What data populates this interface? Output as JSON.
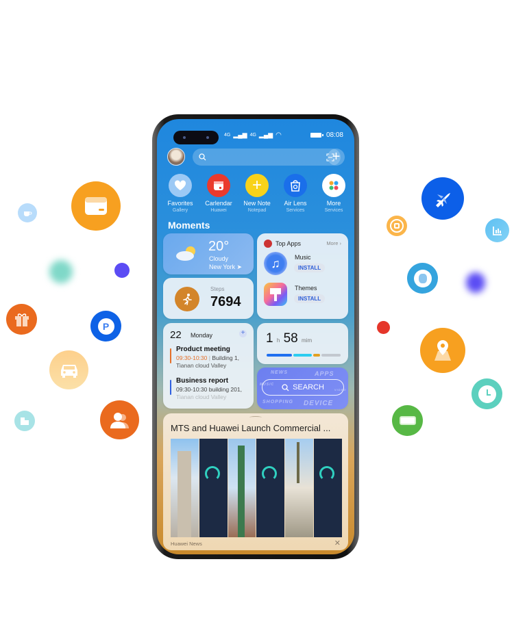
{
  "status_bar": {
    "signal1": "4G",
    "signal2": "4G",
    "time": "08:08"
  },
  "search": {
    "placeholder": ""
  },
  "quick_apps": [
    {
      "label": "Favorites",
      "sublabel": "Gallery",
      "icon": "heart-icon",
      "color": "#9cc9f5"
    },
    {
      "label": "Carlendar",
      "sublabel": "Huawei",
      "icon": "calendar-icon",
      "color": "#ea3a2d"
    },
    {
      "label": "New Note",
      "sublabel": "Notepad",
      "icon": "plus-icon",
      "color": "#f8d21a"
    },
    {
      "label": "Air Lens",
      "sublabel": "Services",
      "icon": "bag-icon",
      "color": "#1a6fea"
    },
    {
      "label": "More",
      "sublabel": "Services",
      "icon": "grid-icon",
      "color": "#ffffff"
    }
  ],
  "section_title": "Moments",
  "weather": {
    "temp": "20°",
    "condition": "Cloudy",
    "city": "New York"
  },
  "steps": {
    "label": "Steps",
    "value": "7694"
  },
  "top_apps": {
    "title": "Top Apps",
    "more": "More",
    "items": [
      {
        "name": "Music",
        "action": "INSTALL"
      },
      {
        "name": "Themes",
        "action": "INSTALL"
      }
    ]
  },
  "calendar": {
    "day": "22",
    "weekday": "Monday",
    "events": [
      {
        "title": "Product meeting",
        "time": "09:30-10:30",
        "location": "Building 1,",
        "location2": "Tianan cloud Valley",
        "color": "#e5702a"
      },
      {
        "title": "Business report",
        "time": "09:30-10:30",
        "location": "building 201,",
        "location2": "Tianan cloud Valley",
        "color": "#2f5fe0"
      }
    ]
  },
  "screen_time": {
    "hours": "1",
    "h_unit": "h",
    "minutes": "58",
    "m_unit": "mim"
  },
  "search_card": {
    "label": "SEARCH",
    "words": [
      "NEWS",
      "APPS",
      "MUSIC",
      "SHOPPING",
      "DEVICE",
      "VIDEO"
    ]
  },
  "news": {
    "headline": "MTS and Huawei Launch Commercial ...",
    "source": "Huawei News"
  },
  "floating_icons": [
    "coffee-icon",
    "wallet-icon",
    "blurred-dot",
    "purple-dot",
    "gift-icon",
    "parking-icon",
    "car-icon",
    "building-icon",
    "contacts-icon",
    "plane-icon",
    "football-icon",
    "chart-icon",
    "globe-icon",
    "blurred-dot",
    "red-dot",
    "location-icon",
    "clock-icon",
    "battery-icon"
  ]
}
